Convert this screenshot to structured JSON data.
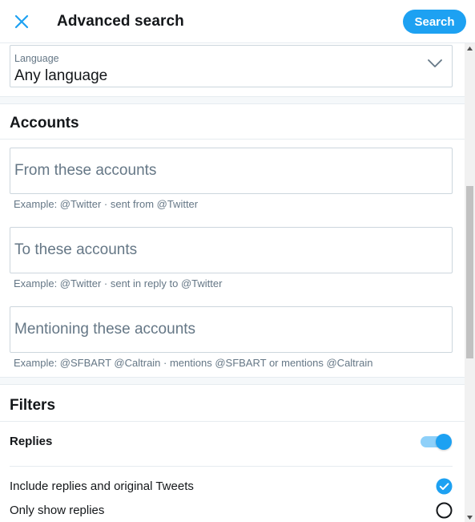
{
  "header": {
    "title": "Advanced search",
    "search_label": "Search",
    "close_icon": "close-icon"
  },
  "language": {
    "label": "Language",
    "value": "Any language",
    "icon": "chevron-down-icon"
  },
  "accounts": {
    "title": "Accounts",
    "fields": [
      {
        "placeholder": "From these accounts",
        "value": "",
        "hint": "Example: @Twitter · sent from @Twitter"
      },
      {
        "placeholder": "To these accounts",
        "value": "",
        "hint": "Example: @Twitter · sent in reply to @Twitter"
      },
      {
        "placeholder": "Mentioning these accounts",
        "value": "",
        "hint": "Example: @SFBART @Caltrain · mentions @SFBART or mentions @Caltrain"
      }
    ]
  },
  "filters": {
    "title": "Filters",
    "replies_label": "Replies",
    "replies_enabled": true,
    "options": [
      {
        "label": "Include replies and original Tweets",
        "selected": true
      },
      {
        "label": "Only show replies",
        "selected": false
      }
    ]
  },
  "colors": {
    "accent": "#1da1f2",
    "text": "#14171a",
    "secondary_text": "#657786",
    "border": "#ccd6dd"
  }
}
